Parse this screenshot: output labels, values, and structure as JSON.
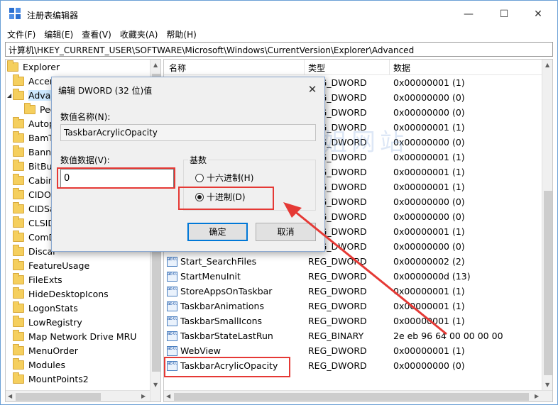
{
  "window": {
    "title": "注册表编辑器",
    "controls": {
      "minimize": "—",
      "maximize": "☐",
      "close": "✕"
    }
  },
  "menu": [
    "文件(F)",
    "编辑(E)",
    "查看(V)",
    "收藏夹(A)",
    "帮助(H)"
  ],
  "address": "计算机\\HKEY_CURRENT_USER\\SOFTWARE\\Microsoft\\Windows\\CurrentVersion\\Explorer\\Advanced",
  "tree": {
    "items": [
      "Explorer",
      "Accen",
      "Advan",
      "Peo",
      "Autop",
      "BamT",
      "Banne",
      "BitBuc",
      "Cabin",
      "CIDOp",
      "CIDSa",
      "CLSID",
      "ComD",
      "Discar",
      "FeatureUsage",
      "FileExts",
      "HideDesktopIcons",
      "LogonStats",
      "LowRegistry",
      "Map Network Drive MRU",
      "MenuOrder",
      "Modules",
      "MountPoints2"
    ]
  },
  "list": {
    "headers": {
      "name": "名称",
      "type": "类型",
      "data": "数据"
    },
    "icon_label": "ab 011 110",
    "rows": [
      {
        "name": "",
        "type": "REG_DWORD",
        "data": "0x00000001 (1)"
      },
      {
        "name": "",
        "type": "REG_DWORD",
        "data": "0x00000000 (0)"
      },
      {
        "name": "",
        "type": "REG_DWORD",
        "data": "0x00000000 (0)"
      },
      {
        "name": "",
        "type": "REG_DWORD",
        "data": "0x00000001 (1)"
      },
      {
        "name": "",
        "type": "REG_DWORD",
        "data": "0x00000000 (0)"
      },
      {
        "name": "",
        "type": "REG_DWORD",
        "data": "0x00000001 (1)"
      },
      {
        "name": "",
        "type": "REG_DWORD",
        "data": "0x00000001 (1)"
      },
      {
        "name": "",
        "type": "REG_DWORD",
        "data": "0x00000001 (1)"
      },
      {
        "name": "",
        "type": "REG_DWORD",
        "data": "0x00000000 (0)"
      },
      {
        "name": "",
        "type": "REG_DWORD",
        "data": "0x00000000 (0)"
      },
      {
        "name": "",
        "type": "REG_DWORD",
        "data": "0x00000001 (1)"
      },
      {
        "name": "",
        "type": "REG_DWORD",
        "data": "0x00000000 (0)"
      },
      {
        "name": "Start_SearchFiles",
        "type": "REG_DWORD",
        "data": "0x00000002 (2)"
      },
      {
        "name": "StartMenuInit",
        "type": "REG_DWORD",
        "data": "0x0000000d (13)"
      },
      {
        "name": "StoreAppsOnTaskbar",
        "type": "REG_DWORD",
        "data": "0x00000001 (1)"
      },
      {
        "name": "TaskbarAnimations",
        "type": "REG_DWORD",
        "data": "0x00000001 (1)"
      },
      {
        "name": "TaskbarSmallIcons",
        "type": "REG_DWORD",
        "data": "0x00000001 (1)"
      },
      {
        "name": "TaskbarStateLastRun",
        "type": "REG_BINARY",
        "data": "2e eb 96 64 00 00 00 00"
      },
      {
        "name": "WebView",
        "type": "REG_DWORD",
        "data": "0x00000001 (1)"
      },
      {
        "name": "TaskbarAcrylicOpacity",
        "type": "REG_DWORD",
        "data": "0x00000000 (0)"
      }
    ]
  },
  "watermark": "亿破姐网站",
  "dialog": {
    "title": "编辑 DWORD (32 位)值",
    "close": "✕",
    "value_name_label": "数值名称(N):",
    "value_name": "TaskbarAcrylicOpacity",
    "value_data_label": "数值数据(V):",
    "value_data": "0",
    "base_label": "基数",
    "hex_label": "十六进制(H)",
    "dec_label": "十进制(D)",
    "ok": "确定",
    "cancel": "取消"
  },
  "colors": {
    "annotation": "#e53935",
    "selection": "#cce8ff",
    "default_button_border": "#0078d7"
  }
}
